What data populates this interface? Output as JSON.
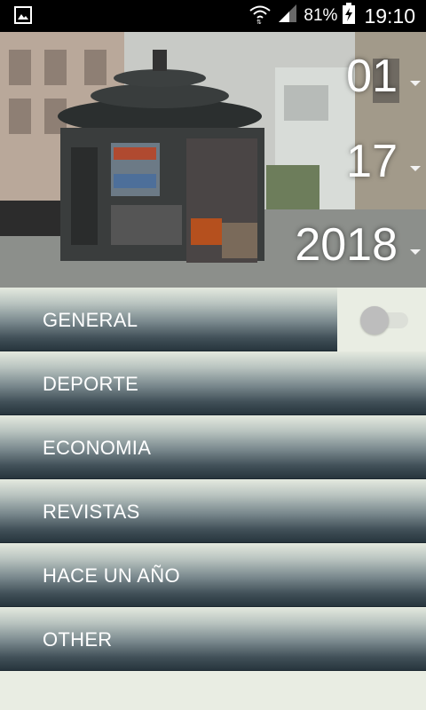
{
  "status_bar": {
    "battery": "81%",
    "time": "19:10",
    "icons": [
      "gallery-icon",
      "wifi-icon",
      "signal-icon",
      "battery-icon"
    ]
  },
  "date_picker": {
    "month": "01",
    "day": "17",
    "year": "2018"
  },
  "categories": [
    {
      "label": "GENERAL"
    },
    {
      "label": "DEPORTE"
    },
    {
      "label": "ECONOMIA"
    },
    {
      "label": "REVISTAS"
    },
    {
      "label": "HACE UN AÑO"
    },
    {
      "label": "OTHER"
    }
  ],
  "toggle": {
    "state": "off"
  },
  "colors": {
    "background": "#e9ede3",
    "category_top": "#e4e9df",
    "category_bottom": "#27353d",
    "status_bar": "#000000"
  }
}
